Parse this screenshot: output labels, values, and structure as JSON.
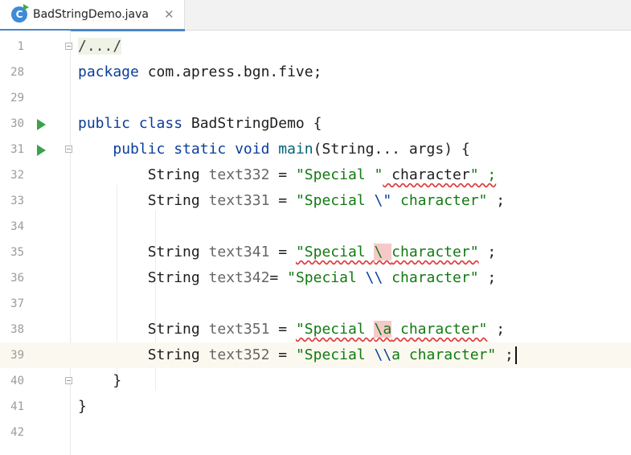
{
  "tab": {
    "filename": "BadStringDemo.java",
    "icon": "java-class-icon"
  },
  "lines": [
    {
      "num": "1",
      "code": "/.../"
    },
    {
      "num": "28",
      "code": "package com.apress.bgn.five;"
    },
    {
      "num": "29",
      "code": ""
    },
    {
      "num": "30",
      "code": "public class BadStringDemo {"
    },
    {
      "num": "31",
      "code": "    public static void main(String... args) {"
    },
    {
      "num": "32",
      "code": "        String text332 = \"Special \" character\" ;"
    },
    {
      "num": "33",
      "code": "        String text331 = \"Special \\\" character\" ;"
    },
    {
      "num": "34",
      "code": ""
    },
    {
      "num": "35",
      "code": "        String text341 = \"Special \\ character\" ;"
    },
    {
      "num": "36",
      "code": "        String text342= \"Special \\\\ character\" ;"
    },
    {
      "num": "37",
      "code": ""
    },
    {
      "num": "38",
      "code": "        String text351 = \"Special \\a character\" ;"
    },
    {
      "num": "39",
      "code": "        String text352 = \"Special \\\\a character\" ;"
    },
    {
      "num": "40",
      "code": "    }"
    },
    {
      "num": "41",
      "code": "}"
    },
    {
      "num": "42",
      "code": ""
    }
  ],
  "colors": {
    "keyword": "#0b3d9b",
    "string": "#117a11",
    "run_icon": "#3ba24a",
    "error_underline": "#e04040"
  }
}
